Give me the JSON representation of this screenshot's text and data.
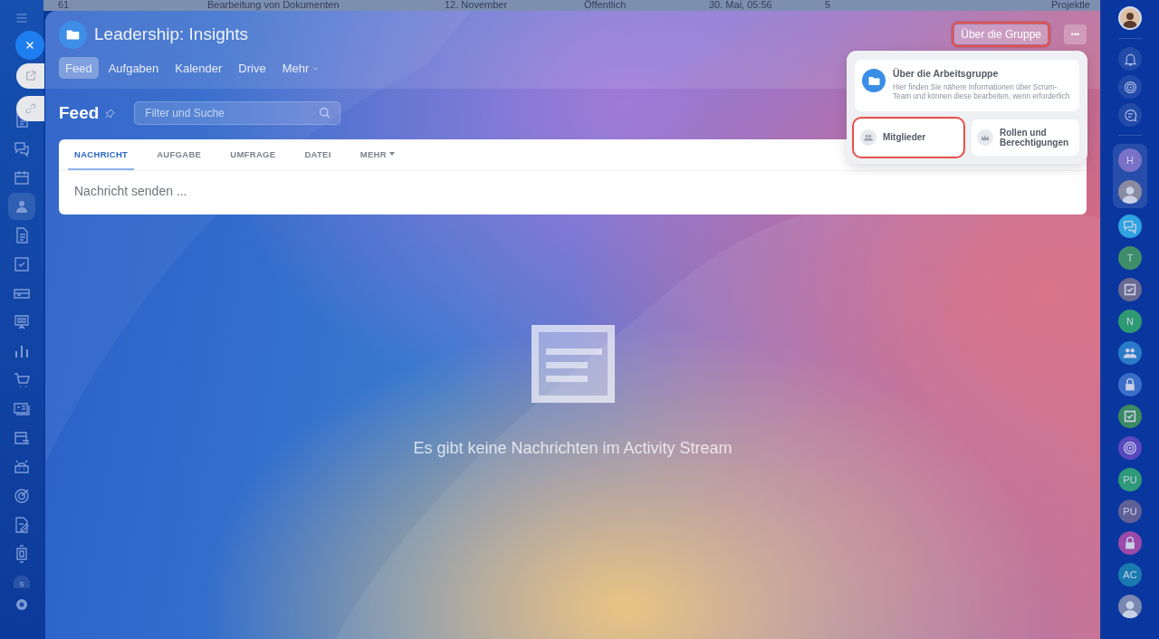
{
  "background_row": {
    "number": "61",
    "title": "Bearbeitung von Dokumenten",
    "date": "12. November",
    "visibility": "Öffentlich",
    "modified": "30. Mai, 05:56",
    "count": "5",
    "role": "Projektle"
  },
  "left_sidebar": {
    "user_badge": "S"
  },
  "group": {
    "title": "Leadership: Insights",
    "tabs": [
      {
        "label": "Feed",
        "selected": true
      },
      {
        "label": "Aufgaben",
        "selected": false
      },
      {
        "label": "Kalender",
        "selected": false
      },
      {
        "label": "Drive",
        "selected": false
      },
      {
        "label": "Mehr",
        "selected": false
      }
    ],
    "about_button": {
      "label": "Über die Gruppe",
      "highlighted": true
    },
    "more_button": {
      "label": "•••"
    }
  },
  "popup": {
    "about": {
      "title": "Über die Arbeitsgruppe",
      "description": "Hier finden Sie nähere Informationen über Scrum-Team und können diese bearbeiten, wenn erforderlich"
    },
    "members": {
      "label": "Mitglieder",
      "highlighted": true
    },
    "roles": {
      "label": "Rollen und Berechtigungen",
      "highlighted": false
    }
  },
  "feed": {
    "title": "Feed",
    "search": {
      "placeholder": "Filter und Suche"
    },
    "composer_tabs": [
      {
        "label": "NACHRICHT",
        "selected": true
      },
      {
        "label": "AUFGABE",
        "selected": false
      },
      {
        "label": "UMFRAGE",
        "selected": false
      },
      {
        "label": "DATEI",
        "selected": false
      },
      {
        "label": "MEHR",
        "selected": false
      }
    ],
    "composer": {
      "placeholder": "Nachricht senden ..."
    },
    "empty_message": "Es gibt keine Nachrichten im Activity Stream"
  },
  "right_bar": {
    "items": [
      {
        "kind": "letter",
        "text": "H",
        "color": "#7a72c8"
      },
      {
        "kind": "avatar",
        "color": "#8a8aa0"
      },
      {
        "kind": "chat",
        "color": "#2ea3e0"
      },
      {
        "kind": "letter",
        "text": "T",
        "color": "#3f8e6a"
      },
      {
        "kind": "checkbox",
        "color": "#6a6a90"
      },
      {
        "kind": "letter",
        "text": "N",
        "color": "#2e9a72"
      },
      {
        "kind": "people",
        "color": "#2a7ac8"
      },
      {
        "kind": "lock",
        "color": "#3a6ec8"
      },
      {
        "kind": "checkbox",
        "color": "#3a8a62"
      },
      {
        "kind": "spiral",
        "color": "#5a48c0"
      },
      {
        "kind": "letter",
        "text": "PU",
        "color": "#2e9a78"
      },
      {
        "kind": "letter",
        "text": "PU",
        "color": "#5e6096"
      },
      {
        "kind": "lock",
        "color": "#9a4aa8"
      },
      {
        "kind": "letter",
        "text": "AC",
        "color": "#1a7ab0"
      },
      {
        "kind": "avatar",
        "color": "#7a88b0"
      }
    ]
  }
}
